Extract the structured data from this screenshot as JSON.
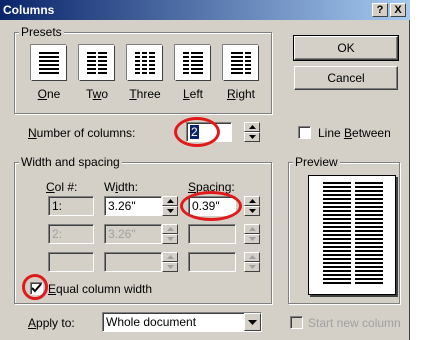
{
  "window": {
    "title": "Columns",
    "help_label": "?",
    "close_label": "X"
  },
  "presets": {
    "group_label": "Presets",
    "items": [
      {
        "mnemonic": "O",
        "rest": "ne"
      },
      {
        "mnemonic": "w",
        "pre": "T",
        "rest": "o"
      },
      {
        "mnemonic": "T",
        "rest": "hree"
      },
      {
        "mnemonic": "L",
        "rest": "eft"
      },
      {
        "mnemonic": "R",
        "rest": "ight"
      }
    ]
  },
  "buttons": {
    "ok": "OK",
    "cancel": "Cancel"
  },
  "number_of_columns": {
    "label_mnemonic": "N",
    "label_rest": "umber of columns:",
    "value": "2"
  },
  "line_between": {
    "label_mnemonic": "B",
    "label_pre": "Line ",
    "label_rest": "etween",
    "checked": false
  },
  "width_spacing": {
    "group_label": "Width and spacing",
    "col_header": "Col #:",
    "width_header_pre": "W",
    "width_header_mnemonic": "i",
    "width_header_rest": "dth:",
    "spacing_header_mnemonic": "S",
    "spacing_header_rest": "pacing:",
    "rows": [
      {
        "col": "1:",
        "width": "3.26\"",
        "spacing": "0.39\""
      },
      {
        "col": "2:",
        "width": "3.26\"",
        "spacing": ""
      },
      {
        "col": "",
        "width": "",
        "spacing": ""
      }
    ]
  },
  "equal_column_width": {
    "label_mnemonic": "E",
    "label_rest": "qual column width",
    "checked": true
  },
  "apply_to": {
    "label_pre": "Apply to:",
    "value": "Whole document"
  },
  "start_new_column": {
    "label": "Start new column",
    "checked": false
  },
  "preview": {
    "group_label": "Preview"
  },
  "colors": {
    "titlebar_start": "#0a246a",
    "titlebar_end": "#a6caf0",
    "highlight_ring": "#e01a1a",
    "dialog_bg": "#d4d0c8"
  }
}
